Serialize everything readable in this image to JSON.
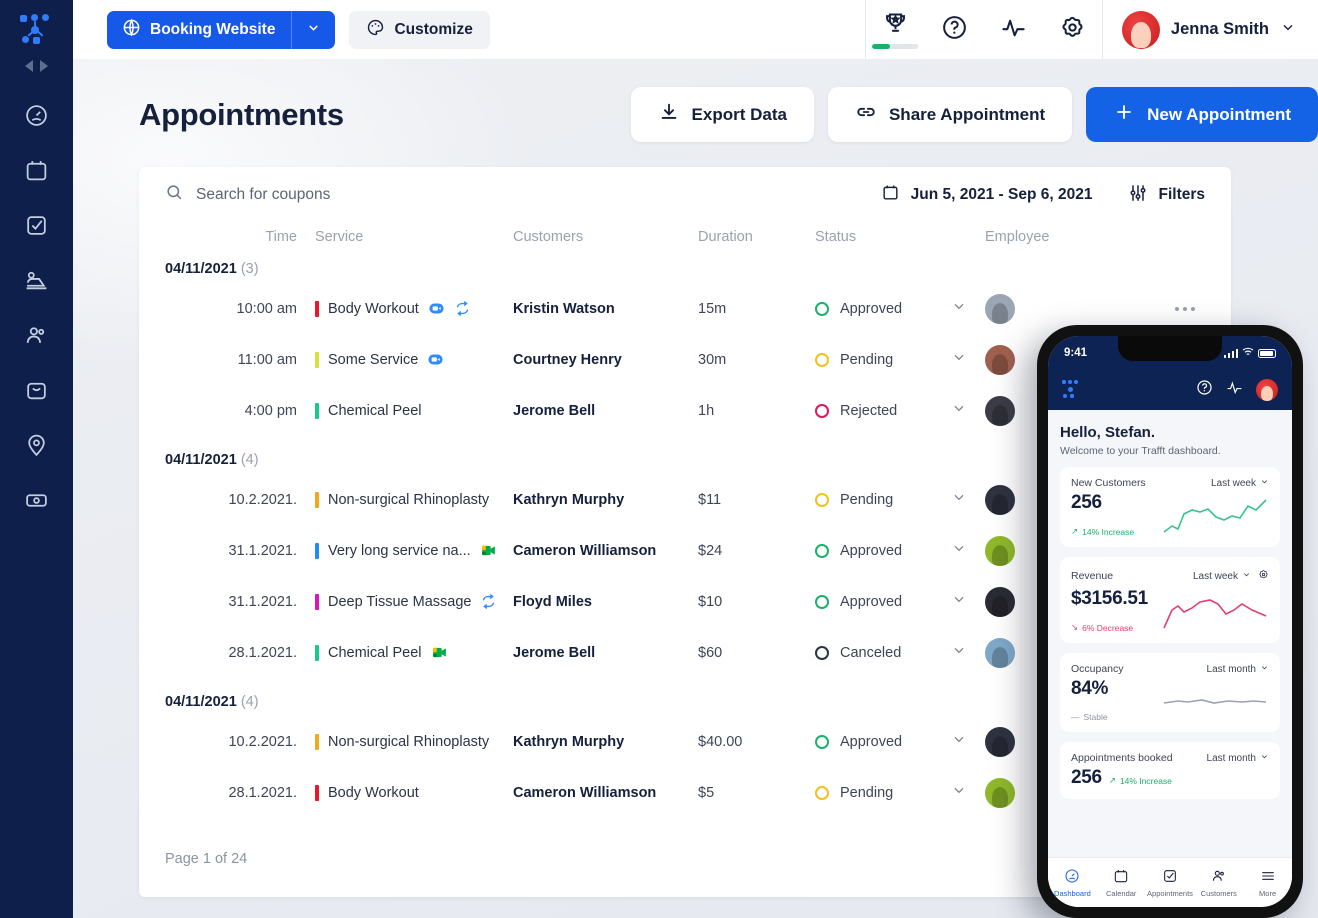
{
  "sidebar": {
    "logo_name": "trafft-logo",
    "collapse_label": "collapse-sidebar",
    "items": [
      {
        "icon": "dashboard-icon",
        "name": "sidebar-item-dashboard"
      },
      {
        "icon": "calendar-icon",
        "name": "sidebar-item-calendar"
      },
      {
        "icon": "appointments-icon",
        "name": "sidebar-item-appointments"
      },
      {
        "icon": "employees-icon",
        "name": "sidebar-item-employees"
      },
      {
        "icon": "customers-icon",
        "name": "sidebar-item-customers"
      },
      {
        "icon": "services-icon",
        "name": "sidebar-item-services"
      },
      {
        "icon": "locations-icon",
        "name": "sidebar-item-locations"
      },
      {
        "icon": "finance-icon",
        "name": "sidebar-item-finance"
      }
    ]
  },
  "topbar": {
    "booking_website_label": "Booking Website",
    "customize_label": "Customize",
    "user_name": "Jenna Smith",
    "trophy_progress": "38%"
  },
  "header": {
    "title": "Appointments",
    "export_label": "Export Data",
    "share_label": "Share Appointment",
    "new_label": "New Appointment"
  },
  "search": {
    "placeholder": "Search for coupons"
  },
  "daterange": {
    "value": "Jun 5, 2021 - Sep 6, 2021"
  },
  "filters": {
    "label": "Filters"
  },
  "table": {
    "columns": [
      "Time",
      "Service",
      "Customers",
      "Duration",
      "Status",
      "Employee"
    ],
    "groups": [
      {
        "date": "04/11/2021",
        "count": "(3)",
        "rows": [
          {
            "time": "10:00 am",
            "service": "Body Workout",
            "color": "#e8182a",
            "badges": [
              "zoom-icon",
              "recurring-icon"
            ],
            "customer": "Kristin Watson",
            "duration": "15m",
            "status": "Approved",
            "status_color": "#19b26b",
            "avatar": "#9aa6b4"
          },
          {
            "time": "11:00 am",
            "service": "Some Service",
            "color": "#d4e23a",
            "badges": [
              "zoom-icon"
            ],
            "customer": "Courtney Henry",
            "duration": "30m",
            "status": "Pending",
            "status_color": "#f2c11b",
            "avatar": "#a06050"
          },
          {
            "time": "4:00 pm",
            "service": "Chemical Peel",
            "color": "#19c98a",
            "badges": [],
            "customer": "Jerome Bell",
            "duration": "1h",
            "status": "Rejected",
            "status_color": "#d81b60",
            "avatar": "#3c3c46"
          }
        ]
      },
      {
        "date": "04/11/2021",
        "count": "(4)",
        "rows": [
          {
            "time": "10.2.2021.",
            "service": "Non-surgical Rhinoplasty",
            "color": "#f2a81b",
            "badges": [],
            "customer": "Kathryn Murphy",
            "duration": "$11",
            "status": "Pending",
            "status_color": "#f2c11b",
            "avatar": "#2f3340"
          },
          {
            "time": "31.1.2021.",
            "service": "Very long service na...",
            "color": "#1f8df5",
            "badges": [
              "meet-icon"
            ],
            "customer": "Cameron Williamson",
            "duration": "$24",
            "status": "Approved",
            "status_color": "#19b26b",
            "avatar": "#8fb82a"
          },
          {
            "time": "31.1.2021.",
            "service": "Deep Tissue Massage",
            "color": "#d916b6",
            "badges": [
              "recurring-icon"
            ],
            "customer": "Floyd Miles",
            "duration": "$10",
            "status": "Approved",
            "status_color": "#19b26b",
            "avatar": "#2b2b33"
          },
          {
            "time": "28.1.2021.",
            "service": "Chemical Peel",
            "color": "#19c98a",
            "badges": [
              "meet-icon"
            ],
            "customer": "Jerome Bell",
            "duration": "$60",
            "status": "Canceled",
            "status_color": "#2b3347",
            "avatar": "#7fa8c9"
          }
        ]
      },
      {
        "date": "04/11/2021",
        "count": "(4)",
        "rows": [
          {
            "time": "10.2.2021.",
            "service": "Non-surgical Rhinoplasty",
            "color": "#f2a81b",
            "badges": [],
            "customer": "Kathryn Murphy",
            "duration": "$40.00",
            "status": "Approved",
            "status_color": "#19b26b",
            "avatar": "#2f3340"
          },
          {
            "time": "28.1.2021.",
            "service": "Body Workout",
            "color": "#e8182a",
            "badges": [],
            "customer": "Cameron Williamson",
            "duration": "$5",
            "status": "Pending",
            "status_color": "#f2c11b",
            "avatar": "#8fb82a"
          }
        ]
      }
    ]
  },
  "pagination": {
    "page_info": "Page 1 of 24"
  },
  "phone": {
    "status_time": "9:41",
    "greeting": "Hello, Stefan.",
    "welcome": "Welcome to your Trafft dashboard.",
    "cards": [
      {
        "title": "New Customers",
        "period": "Last week",
        "value": "256",
        "delta": "14% Increase",
        "delta_color": "#19b26b",
        "trend": "up",
        "spark_color": "#35c48c"
      },
      {
        "title": "Revenue",
        "period": "Last week",
        "value": "$3156.51",
        "delta": "6% Decrease",
        "delta_color": "#e0416f",
        "trend": "down",
        "spark_color": "#e0416f"
      },
      {
        "title": "Occupancy",
        "period": "Last month",
        "value": "84%",
        "delta": "Stable",
        "delta_color": "#8b94a4",
        "trend": "flat",
        "spark_color": "#9aa2b1"
      },
      {
        "title": "Appointments booked",
        "period": "Last month",
        "value": "256",
        "delta": "14% Increase",
        "delta_color": "#19b26b",
        "trend": "up",
        "spark_color": "#35c48c"
      }
    ],
    "tabs": [
      {
        "label": "Dashboard",
        "icon": "dashboard-icon",
        "active": true
      },
      {
        "label": "Calendar",
        "icon": "calendar-icon",
        "active": false
      },
      {
        "label": "Appointments",
        "icon": "appointments-icon",
        "active": false
      },
      {
        "label": "Customers",
        "icon": "customers-icon",
        "active": false
      },
      {
        "label": "More",
        "icon": "menu-icon",
        "active": false
      }
    ]
  },
  "colors": {
    "brand_blue": "#1463e6",
    "sidebar_navy": "#0d1f4a",
    "page_bg": "#eef0f4",
    "green": "#19b26b",
    "yellow": "#f2c11b",
    "pink": "#d81b60"
  }
}
